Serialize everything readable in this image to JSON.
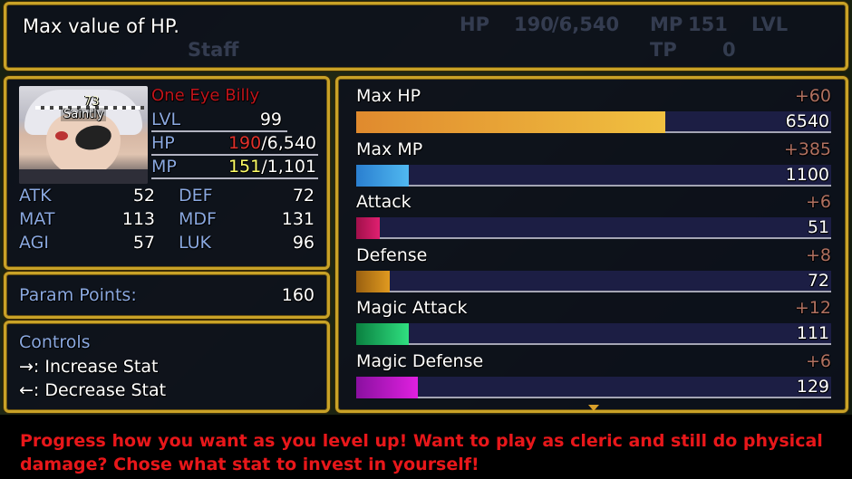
{
  "help": {
    "text": "Max value of HP.",
    "background_hint": {
      "hp_label": "HP",
      "hp_cur": "190",
      "hp_max": "/6,540",
      "mp_label": "MP",
      "mp_cur": "151",
      "tp_label": "TP",
      "tp_val": "0",
      "staff": "Staff",
      "lvl": "LVL"
    }
  },
  "actor": {
    "level_badge": "73",
    "state": "Saintly",
    "name": "One Eye Billy",
    "lv_label": "LVL",
    "lv": "99",
    "hp_label": "HP",
    "hp_cur": "190",
    "hp_max": "/6,540",
    "mp_label": "MP",
    "mp_cur": "151",
    "mp_max": "/1,101"
  },
  "params": [
    {
      "label": "ATK",
      "value": "52"
    },
    {
      "label": "DEF",
      "value": "72"
    },
    {
      "label": "MAT",
      "value": "113"
    },
    {
      "label": "MDF",
      "value": "131"
    },
    {
      "label": "AGI",
      "value": "57"
    },
    {
      "label": "LUK",
      "value": "96"
    }
  ],
  "points": {
    "label": "Param Points:",
    "value": "160"
  },
  "controls": {
    "title": "Controls",
    "increase": "→: Increase Stat",
    "decrease": "←: Decrease Stat"
  },
  "stats": [
    {
      "name": "Max HP",
      "bonus": "+60",
      "value": "6540",
      "fill": 0.65,
      "color_a": "#e08a2e",
      "color_b": "#f0c040"
    },
    {
      "name": "Max MP",
      "bonus": "+385",
      "value": "1100",
      "fill": 0.11,
      "color_a": "#2a7fd0",
      "color_b": "#50b8f0"
    },
    {
      "name": "Attack",
      "bonus": "+6",
      "value": "51",
      "fill": 0.05,
      "color_a": "#a0104a",
      "color_b": "#e02070"
    },
    {
      "name": "Defense",
      "bonus": "+8",
      "value": "72",
      "fill": 0.07,
      "color_a": "#9a6010",
      "color_b": "#e09a20"
    },
    {
      "name": "Magic Attack",
      "bonus": "+12",
      "value": "111",
      "fill": 0.11,
      "color_a": "#0a8040",
      "color_b": "#30e080"
    },
    {
      "name": "Magic Defense",
      "bonus": "+6",
      "value": "129",
      "fill": 0.13,
      "color_a": "#8a10a0",
      "color_b": "#e020e0"
    }
  ],
  "caption": "Progress how you want as you level up!  Want to play as cleric and still do physical damage?  Chose what stat to invest in yourself!"
}
